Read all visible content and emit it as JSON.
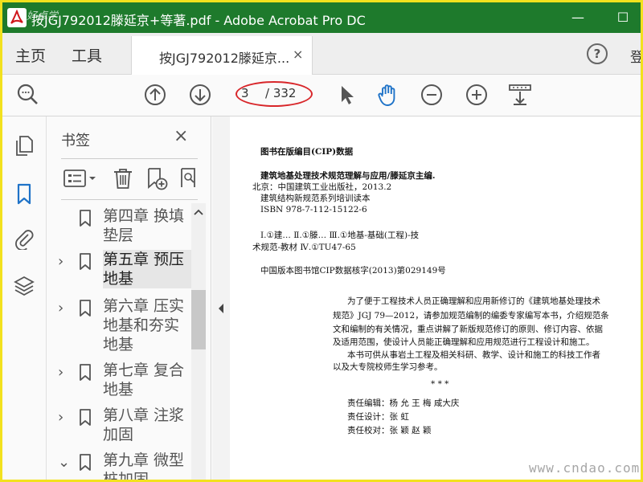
{
  "window": {
    "watermark_tl": "好卓学",
    "title": "按JGJ792012滕延京+等著.pdf - Adobe Acrobat Pro DC",
    "minimize": "—",
    "maximize": "☐"
  },
  "menu": {
    "home": "主页",
    "tools": "工具",
    "doc_tab": "按JGJ792012滕延京...",
    "doc_tab_close": "×",
    "help": "?",
    "cut_label": "登"
  },
  "toolbar": {
    "page_current": "3",
    "page_total": "/ 332"
  },
  "bookmarks": {
    "title": "书签",
    "close": "×",
    "items": [
      {
        "label": "第四章  换填垫层",
        "chevron": ""
      },
      {
        "label": "第五章  预压地基",
        "chevron": "›"
      },
      {
        "label": "第六章  压实地基和夯实地基",
        "chevron": "›"
      },
      {
        "label": "第七章  复合地基",
        "chevron": "›"
      },
      {
        "label": "第八章  注浆加固",
        "chevron": "›"
      },
      {
        "label": "第九章  微型桩加固",
        "chevron": "⌄"
      }
    ]
  },
  "document": {
    "lines": [
      "图书在版编目(CIP)数据",
      "建筑地基处理技术规范理解与应用/滕延京主编.",
      "北京：中国建筑工业出版社，2013.2",
      "建筑结构新规范系列培训读本",
      "ISBN 978-7-112-15122-6",
      "Ⅰ.①建…   Ⅱ.①滕…   Ⅲ.①地基-基础(工程)-技",
      "术规范-教材   Ⅳ.①TU47-65",
      "中国版本图书馆CIP数据核字(2013)第029149号",
      "为了便于工程技术人员正确理解和应用新修订的《建筑地基处理技术",
      "规范》JGJ 79—2012，请参加规范编制的编委专家编写本书，介绍规范条",
      "文和编制的有关情况，重点讲解了新版规范修订的原则、修订内容、依据",
      "及适用范围，使设计人员能正确理解和应用规范进行工程设计和施工。",
      "本书可供从事岩土工程及相关科研、教学、设计和施工的科技工作者",
      "以及大专院校师生学习参考。",
      "*        *        *",
      "责任编辑：杨   允   王   梅   咸大庆",
      "责任设计：张   虹",
      "责任校对：张   颖   赵   颖"
    ]
  },
  "watermark_br": "www.cndao.com"
}
